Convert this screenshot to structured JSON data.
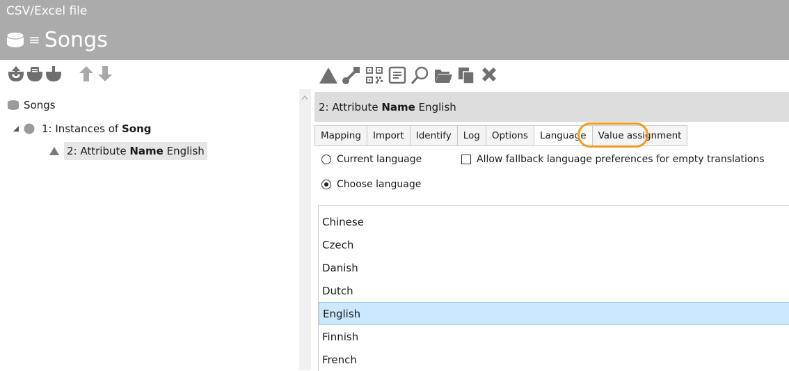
{
  "header": {
    "subtitle": "CSV/Excel file",
    "title": "Songs"
  },
  "tree": {
    "root": "Songs",
    "instances_prefix": "1: Instances of ",
    "instances_bold": "Song",
    "attr_prefix": "2: Attribute ",
    "attr_bold": "Name",
    "attr_suffix": " English"
  },
  "detail": {
    "title_prefix": "2: Attribute ",
    "title_bold": "Name",
    "title_suffix": " English"
  },
  "tabs": [
    "Mapping",
    "Import",
    "Identify",
    "Log",
    "Options",
    "Language",
    "Value assignment"
  ],
  "active_tab": "Language",
  "options": {
    "current_language": "Current language",
    "choose_language": "Choose language",
    "fallback": "Allow fallback language preferences for empty translations",
    "selected_radio": "choose_language",
    "fallback_checked": false
  },
  "languages": [
    "Chinese",
    "Czech",
    "Danish",
    "Dutch",
    "English",
    "Finnish",
    "French"
  ],
  "selected_language": "English",
  "colors": {
    "header_bg": "#ababab",
    "icon_gray": "#6f6f6f",
    "arrow_gray": "#a9a9a9",
    "selection": "#cce8ff",
    "highlight_ring": "#f39a1e"
  }
}
